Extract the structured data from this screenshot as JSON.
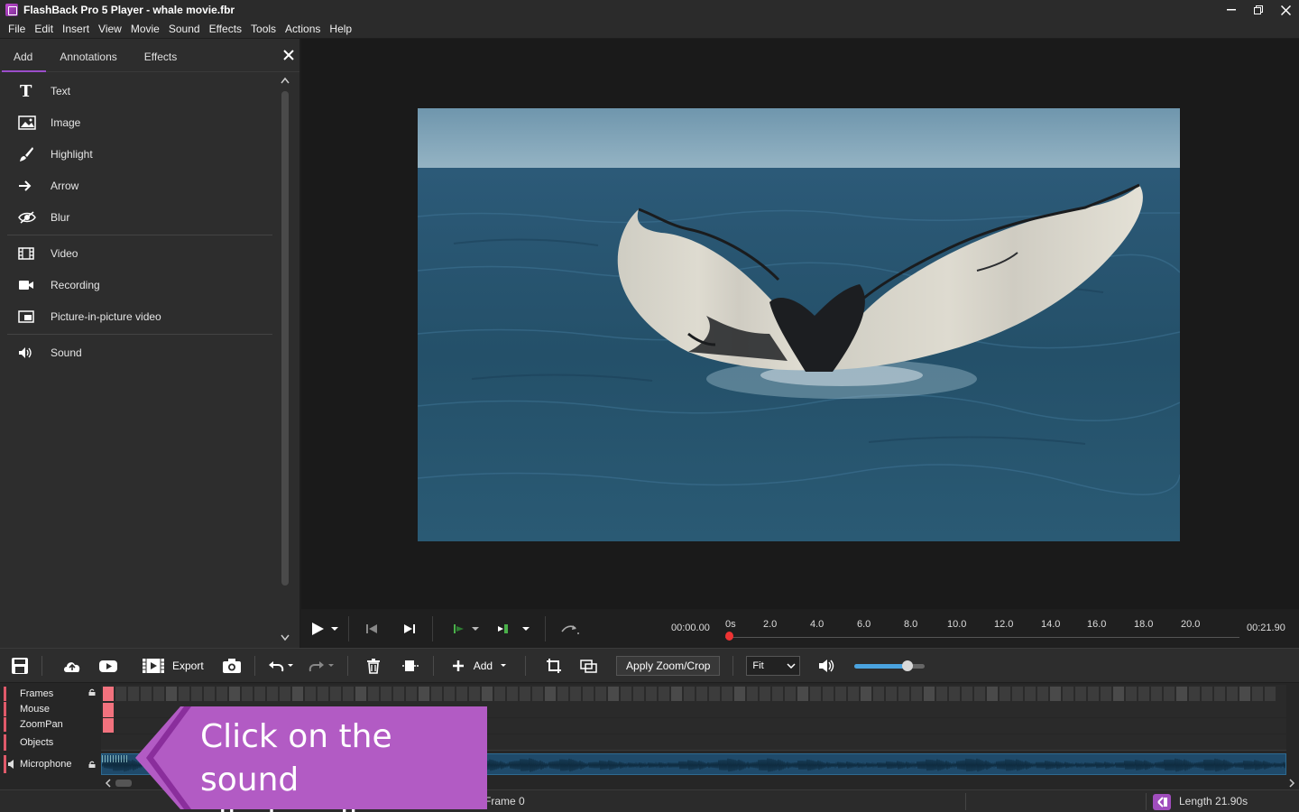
{
  "window": {
    "title": "FlashBack Pro 5 Player - whale movie.fbr",
    "controls": {
      "minimize": "—",
      "restore": "❐",
      "close": "✕"
    }
  },
  "menu": [
    "File",
    "Edit",
    "Insert",
    "View",
    "Movie",
    "Sound",
    "Effects",
    "Tools",
    "Actions",
    "Help"
  ],
  "left_panel": {
    "tabs": [
      {
        "label": "Add",
        "active": true
      },
      {
        "label": "Annotations",
        "active": false
      },
      {
        "label": "Effects",
        "active": false
      }
    ],
    "close_glyph": "✕",
    "groups": [
      [
        {
          "label": "Text",
          "icon": "text-icon"
        },
        {
          "label": "Image",
          "icon": "image-icon"
        },
        {
          "label": "Highlight",
          "icon": "highlight-brush-icon"
        },
        {
          "label": "Arrow",
          "icon": "arrow-icon"
        },
        {
          "label": "Blur",
          "icon": "blur-icon"
        }
      ],
      [
        {
          "label": "Video",
          "icon": "video-film-icon"
        },
        {
          "label": "Recording",
          "icon": "camera-icon"
        },
        {
          "label": "Picture-in-picture video",
          "icon": "pip-icon"
        }
      ],
      [
        {
          "label": "Sound",
          "icon": "speaker-icon"
        }
      ]
    ]
  },
  "playback": {
    "current_time": "00:00.00",
    "total_time": "00:21.90",
    "ruler_unit_label": "0s",
    "ruler_ticks": [
      "2.0",
      "4.0",
      "6.0",
      "8.0",
      "10.0",
      "12.0",
      "14.0",
      "16.0",
      "18.0",
      "20.0"
    ],
    "playhead_position": 0
  },
  "toolbar": {
    "export_label": "Export",
    "add_label": "Add",
    "apply_zoom_label": "Apply Zoom/Crop",
    "fit_value": "Fit",
    "volume_level": 0.75,
    "accent_color": "#4aa3df"
  },
  "timeline": {
    "tracks": [
      {
        "label": "Frames"
      },
      {
        "label": "Mouse"
      },
      {
        "label": "ZoomPan"
      },
      {
        "label": "Objects"
      },
      {
        "label": "Microphone"
      }
    ]
  },
  "status": {
    "frame": "Frame 0",
    "length": "Length 21.90s"
  },
  "callout": {
    "line1": "Click on the sound",
    "line2": "clip handle",
    "color": "#b25bc4"
  }
}
